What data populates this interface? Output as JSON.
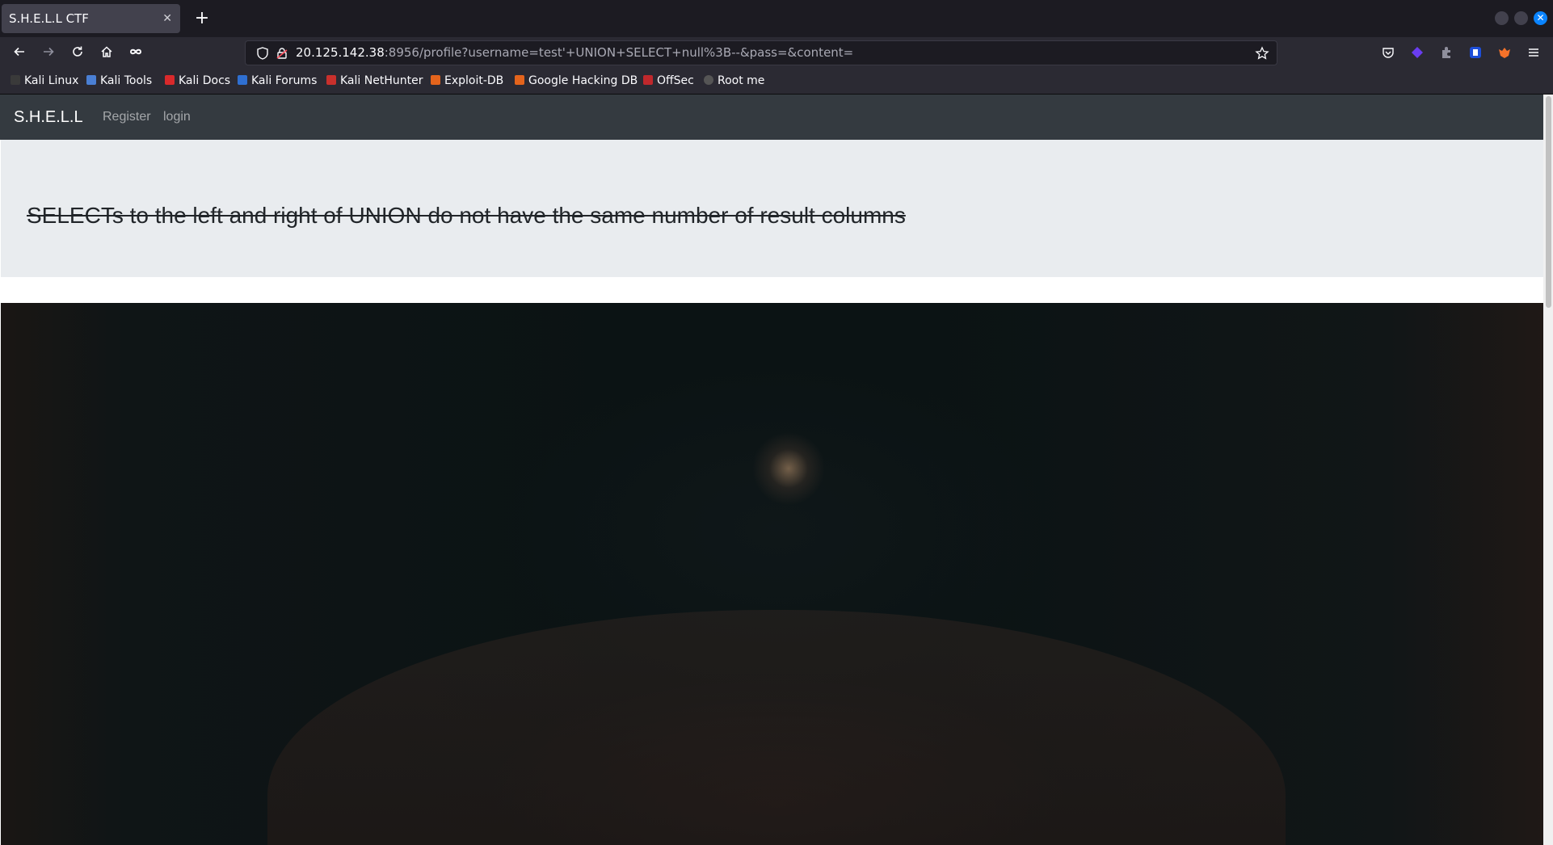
{
  "browser": {
    "tab": {
      "title": "S.H.E.L.L CTF",
      "close_glyph": "✕"
    },
    "new_tab_glyph": "+",
    "window_close_glyph": "✕",
    "url": {
      "host": "20.125.142.38",
      "rest": ":8956/profile?username=test'+UNION+SELECT+null%3B--&pass=&content="
    },
    "bookmarks": [
      {
        "label": "Kali Linux",
        "icon": "kali-linux-icon",
        "color": "#3a3a3a"
      },
      {
        "label": "Kali Tools",
        "icon": "kali-tools-icon",
        "color": "#4a7fd4"
      },
      {
        "label": "Kali Docs",
        "icon": "kali-docs-icon",
        "color": "#d9292b"
      },
      {
        "label": "Kali Forums",
        "icon": "kali-forums-icon",
        "color": "#2f6fd1"
      },
      {
        "label": "Kali NetHunter",
        "icon": "kali-nethunter-icon",
        "color": "#c9302c"
      },
      {
        "label": "Exploit-DB",
        "icon": "exploit-db-icon",
        "color": "#e4641c"
      },
      {
        "label": "Google Hacking DB",
        "icon": "google-hacking-db-icon",
        "color": "#e4641c"
      },
      {
        "label": "OffSec",
        "icon": "offsec-icon",
        "color": "#c0282c"
      },
      {
        "label": "Root me",
        "icon": "root-me-icon",
        "color": "#555555"
      }
    ]
  },
  "site": {
    "brand": "S.H.E.L.L",
    "links": [
      "Register",
      "login"
    ],
    "error_message": "SELECTs to the left and right of UNION do not have the same number of result columns"
  },
  "colors": {
    "accent": "#0a84ff",
    "site_nav": "#343a40",
    "jumbotron": "#e9ecef"
  }
}
